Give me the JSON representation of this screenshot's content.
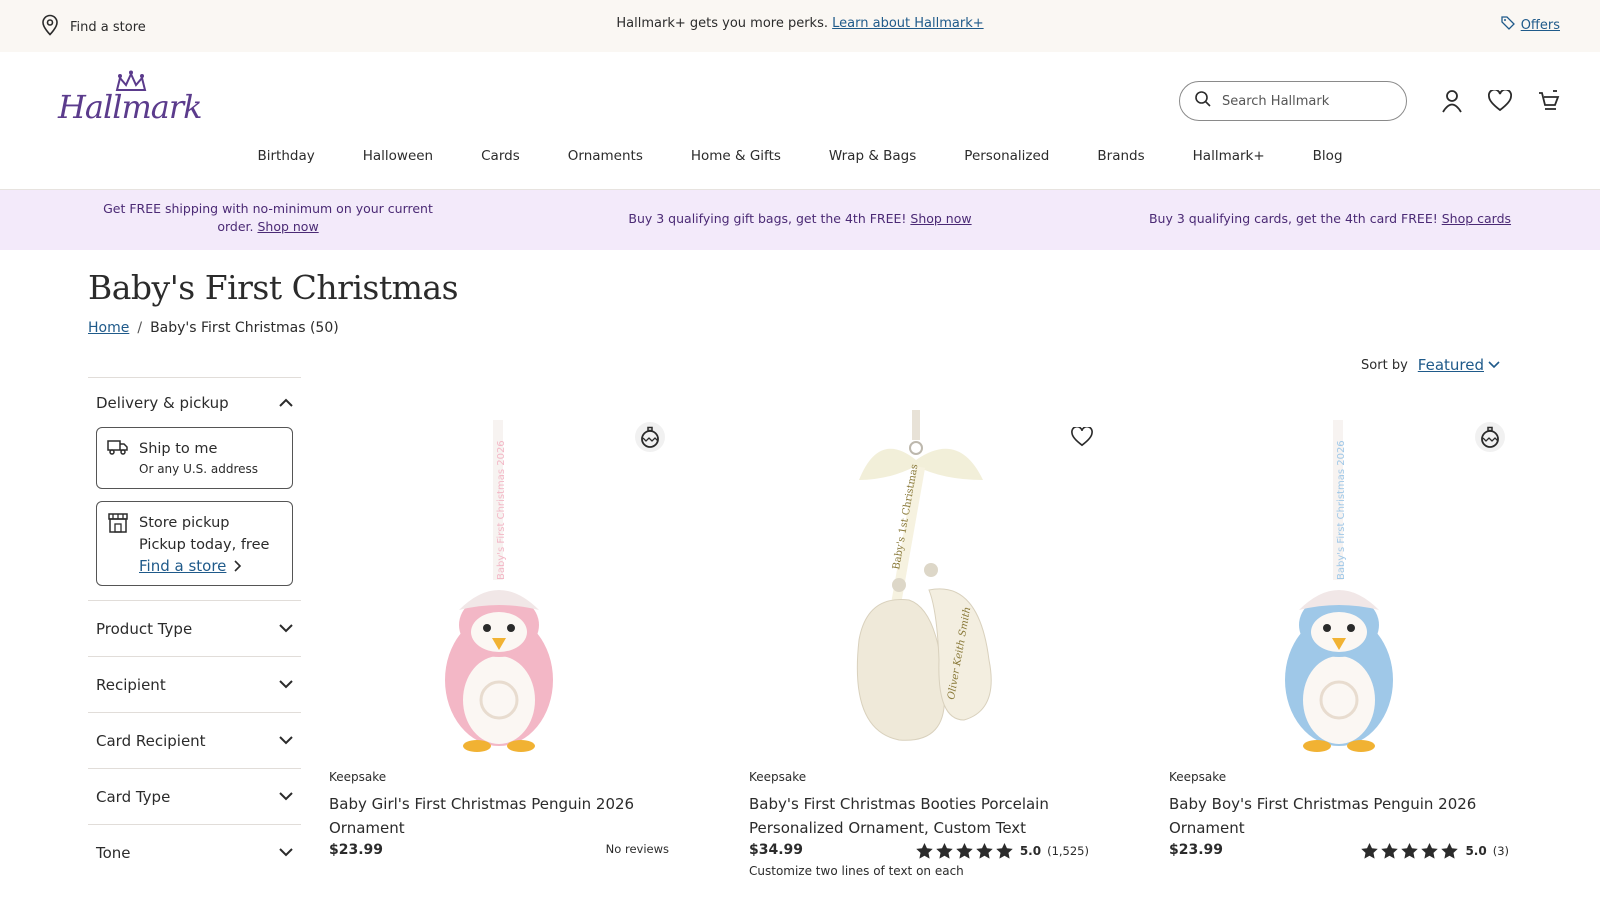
{
  "utility": {
    "find_store": "Find a store",
    "promo_text": "Hallmark+ gets you more perks.",
    "promo_link": "Learn about Hallmark+",
    "offers": "Offers"
  },
  "header": {
    "logo_text": "Hallmark",
    "search_placeholder": "Search Hallmark",
    "nav": [
      "Birthday",
      "Halloween",
      "Cards",
      "Ornaments",
      "Home & Gifts",
      "Wrap & Bags",
      "Personalized",
      "Brands",
      "Hallmark+",
      "Blog"
    ]
  },
  "promos": [
    {
      "text": "Get FREE shipping with no-minimum on your current order.",
      "link": "Shop now"
    },
    {
      "text": "Buy 3 qualifying gift bags, get the 4th FREE!",
      "link": "Shop now"
    },
    {
      "text": "Buy 3 qualifying cards, get the 4th card FREE!",
      "link": "Shop cards"
    }
  ],
  "page": {
    "title": "Baby's First Christmas",
    "breadcrumb_home": "Home",
    "breadcrumb_sep": "/",
    "breadcrumb_current": "Baby's First Christmas (50)",
    "sort_label": "Sort by",
    "sort_value": "Featured"
  },
  "filters": {
    "delivery": "Delivery & pickup",
    "ship_title": "Ship to me",
    "ship_sub": "Or any U.S. address",
    "pickup_title": "Store pickup",
    "pickup_sub": "Pickup today, free",
    "pickup_link": "Find a store",
    "groups": [
      "Product Type",
      "Recipient",
      "Card Recipient",
      "Card Type",
      "Tone"
    ]
  },
  "products": [
    {
      "brand": "Keepsake",
      "name": "Baby Girl's First Christmas Penguin 2026 Ornament",
      "price": "$23.99",
      "reviews": "No reviews",
      "rating": null,
      "count": null,
      "note": null,
      "color": "#f3b7c6",
      "ribbon_text": "Baby's First Christmas 2026"
    },
    {
      "brand": "Keepsake",
      "name": "Baby's First Christmas Booties Porcelain Personalized Ornament, Custom Text",
      "price": "$34.99",
      "reviews": null,
      "rating": "5.0",
      "count": "(1,525)",
      "note": "Customize two lines of text on each",
      "color": "#efe9d9",
      "ribbon_text": "Baby's 1st Christmas"
    },
    {
      "brand": "Keepsake",
      "name": "Baby Boy's First Christmas Penguin 2026 Ornament",
      "price": "$23.99",
      "reviews": null,
      "rating": "5.0",
      "count": "(3)",
      "note": null,
      "color": "#9fc8e8",
      "ribbon_text": "Baby's First Christmas 2026"
    }
  ],
  "colors": {
    "link": "#1f5a8a",
    "brand_purple": "#5b3b8c",
    "promo_bg": "#f3eafa",
    "utility_bg": "#faf7f3"
  }
}
